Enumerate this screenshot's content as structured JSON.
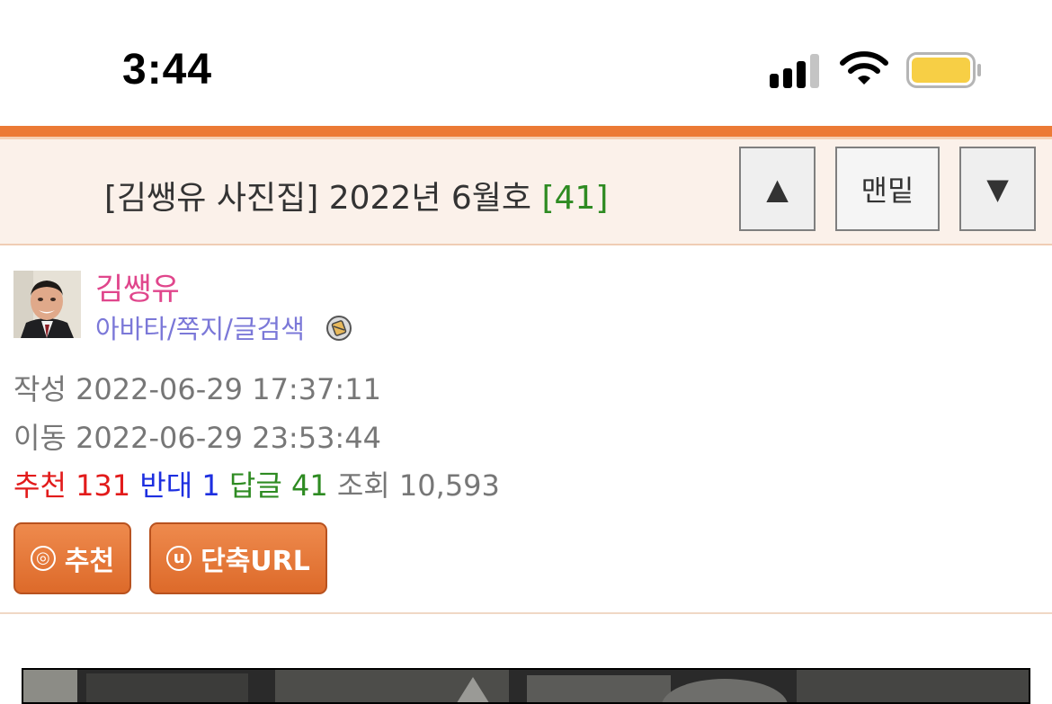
{
  "status_bar": {
    "time": "3:44",
    "signal_icon": "cellular-signal-icon",
    "wifi_icon": "wifi-icon",
    "battery_icon": "battery-icon",
    "battery_color": "#f7cf45"
  },
  "header": {
    "title": "[김쌩유 사진집] 2022년 6월호",
    "comment_count": "[41]",
    "buttons": {
      "up": "▲",
      "bottom": "맨밑",
      "down": "▼"
    }
  },
  "author": {
    "name": "김쌩유",
    "links": "아바타/쪽지/글검색",
    "avatar_icon": "avatar",
    "mail_icon": "message-icon"
  },
  "meta": {
    "written_label": "작성",
    "written_value": "2022-06-29 17:37:11",
    "moved_label": "이동",
    "moved_value": "2022-06-29 23:53:44"
  },
  "stats": {
    "recommend_label": "추천",
    "recommend_value": "131",
    "oppose_label": "반대",
    "oppose_value": "1",
    "reply_label": "답글",
    "reply_value": "41",
    "views_label": "조회",
    "views_value": "10,593"
  },
  "actions": {
    "recommend_glyph": "◎",
    "recommend_label": "추천",
    "shorturl_glyph": "u",
    "shorturl_label": "단축URL"
  },
  "colors": {
    "accent": "#ec7a35",
    "band": "#fbf1ea",
    "author_name": "#e0468c",
    "links": "#7b78d8",
    "recommend": "#e21b1b",
    "oppose": "#1d2fe0",
    "reply": "#2e8b22"
  }
}
